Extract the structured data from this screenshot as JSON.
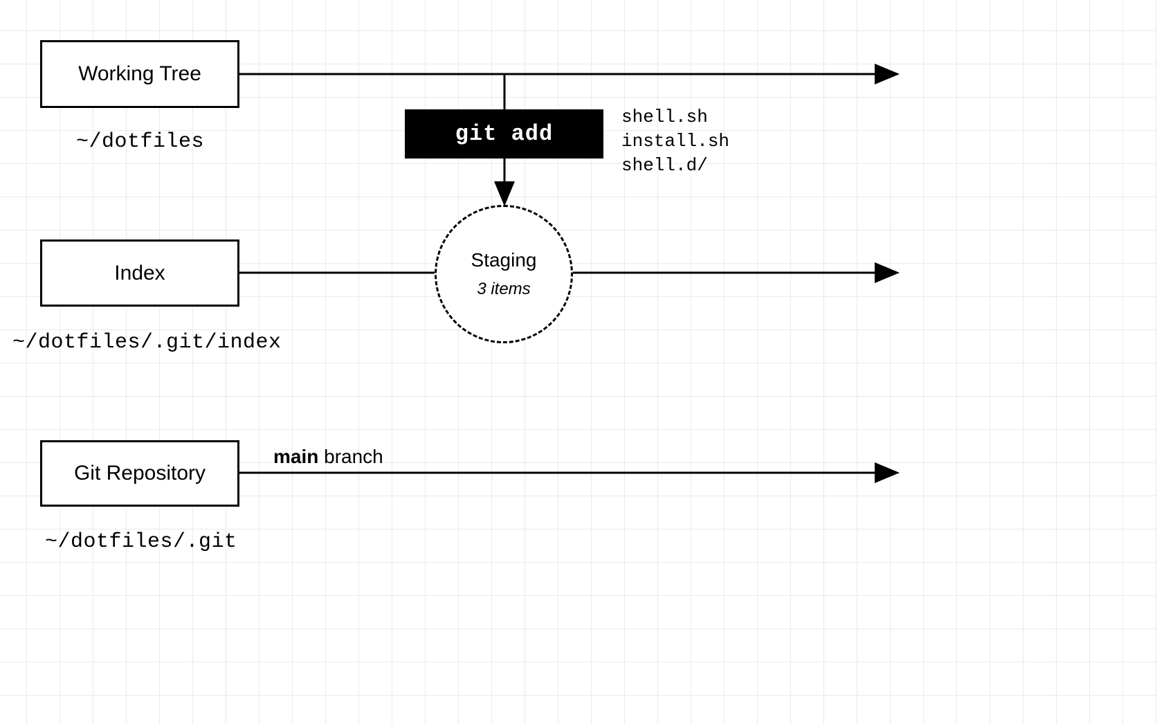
{
  "working_tree": {
    "label": "Working Tree",
    "path": "~/dotfiles"
  },
  "index": {
    "label": "Index",
    "path": "~/dotfiles/.git/index"
  },
  "repository": {
    "label": "Git Repository",
    "path": "~/dotfiles/.git"
  },
  "command": {
    "label": "git add",
    "files": [
      "shell.sh",
      "install.sh",
      "shell.d/"
    ]
  },
  "staging": {
    "title": "Staging",
    "subtitle": "3 items"
  },
  "branch": {
    "name": "main",
    "suffix": "branch"
  }
}
